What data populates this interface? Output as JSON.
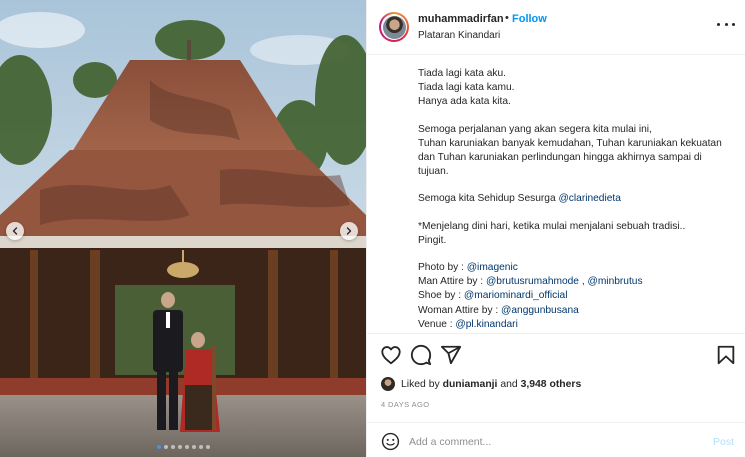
{
  "post": {
    "author": {
      "username": "muhammadirfan",
      "separator": "•",
      "follow_label": "Follow",
      "location": "Plataran Kinandari"
    },
    "caption": [
      [
        {
          "t": "Tiada lagi kata aku."
        }
      ],
      [
        {
          "t": "Tiada lagi kata kamu."
        }
      ],
      [
        {
          "t": "Hanya ada kata kita."
        }
      ],
      [],
      [
        {
          "t": "Semoga perjalanan yang akan segera kita mulai ini,"
        }
      ],
      [
        {
          "t": "Tuhan karuniakan banyak kemudahan, Tuhan karuniakan kekuatan"
        }
      ],
      [
        {
          "t": "dan Tuhan karuniakan perlindungan hingga akhirnya sampai di"
        }
      ],
      [
        {
          "t": "tujuan."
        }
      ],
      [],
      [
        {
          "t": "Semoga kita Sehidup Sesurga "
        },
        {
          "t": "@clarinedieta",
          "link": true
        }
      ],
      [],
      [
        {
          "t": "*Menjelang dini hari, ketika mulai menjalani sebuah tradisi.."
        }
      ],
      [
        {
          "t": "Pingit."
        }
      ],
      [],
      [
        {
          "t": "Photo by : "
        },
        {
          "t": "@imagenic",
          "link": true
        }
      ],
      [
        {
          "t": "Man Attire by : "
        },
        {
          "t": "@brutusrumahmode",
          "link": true
        },
        {
          "t": " , "
        },
        {
          "t": "@minbrutus",
          "link": true
        }
      ],
      [
        {
          "t": "Shoe by : "
        },
        {
          "t": "@mariominardi_official",
          "link": true
        }
      ],
      [
        {
          "t": "Woman Attire by : "
        },
        {
          "t": "@anggunbusana",
          "link": true
        }
      ],
      [
        {
          "t": "Venue : "
        },
        {
          "t": "@pl.kinandari",
          "link": true
        }
      ]
    ],
    "carousel": {
      "slide_count": 8,
      "active_slide": 1
    },
    "likes": {
      "prefix": "Liked by",
      "user": "duniamanji",
      "middle": "and",
      "others": "3,948 others"
    },
    "date_label": "4 DAYS AGO",
    "comment": {
      "placeholder": "Add a comment...",
      "post_label": "Post"
    }
  },
  "icons": {
    "more": "more-options-icon",
    "like": "heart-icon",
    "comment": "comment-icon",
    "share": "share-icon",
    "save": "bookmark-icon",
    "emoji": "emoji-icon",
    "prev": "chevron-left-icon",
    "next": "chevron-right-icon"
  },
  "colors": {
    "accent": "#0095f6",
    "link": "#00376b",
    "muted": "#8e8e8e",
    "post_disabled": "#b2dffc"
  }
}
